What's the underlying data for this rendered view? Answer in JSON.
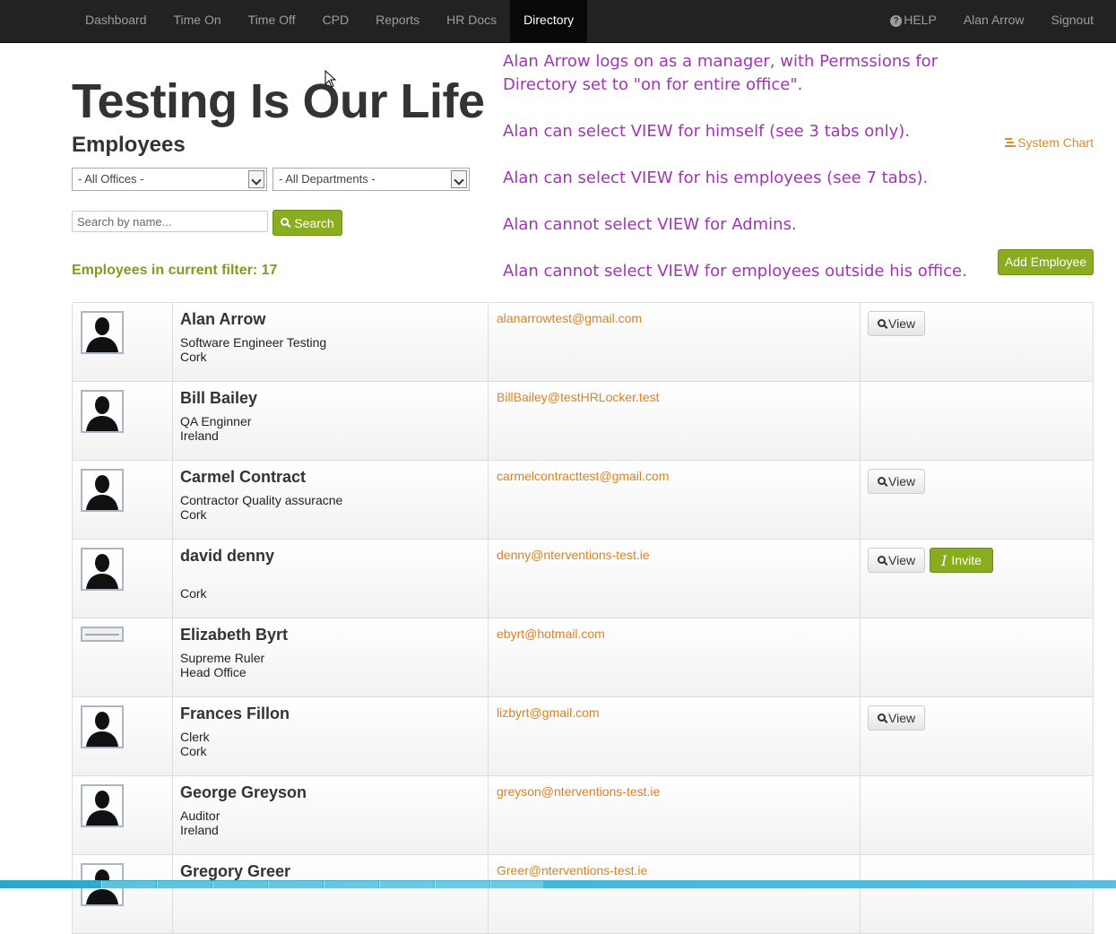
{
  "nav": {
    "left": [
      "Dashboard",
      "Time On",
      "Time Off",
      "CPD",
      "Reports",
      "HR Docs",
      "Directory"
    ],
    "active": "Directory",
    "help": "HELP",
    "user": "Alan Arrow",
    "signout": "Signout"
  },
  "header": {
    "company": "Testing Is Our Life",
    "section": "Employees"
  },
  "filters": {
    "offices": "- All Offices -",
    "departments": "- All Departments -",
    "search_placeholder": "Search by name...",
    "search_label": "Search",
    "count_label": "Employees in current filter: 17"
  },
  "annotations": [
    "Alan Arrow logs on as a manager, with Permssions for",
    "Directory set to \"on for entire office\".",
    "Alan can select VIEW for himself (see 3 tabs only).",
    "Alan can select VIEW for his employees (see 7 tabs).",
    "Alan cannot select VIEW for Admins.",
    "Alan cannot select VIEW for employees outside his office."
  ],
  "actions": {
    "system_chart": "System Chart",
    "add_employee": "Add Employee",
    "view_label": "View",
    "invite_label": "Invite"
  },
  "employees": [
    {
      "name": "Alan Arrow",
      "title": "Software Engineer Testing",
      "office": "Cork",
      "email": "alanarrowtest@gmail.com"
    },
    {
      "name": "Bill Bailey",
      "title": "QA Enginner",
      "office": "Ireland",
      "email": "BillBailey@testHRLocker.test"
    },
    {
      "name": "Carmel Contract",
      "title": "Contractor Quality assuracne",
      "office": "Cork",
      "email": "carmelcontracttest@gmail.com"
    },
    {
      "name": "david denny",
      "title": "",
      "office": "Cork",
      "email": "denny@nterventions-test.ie"
    },
    {
      "name": "Elizabeth Byrt",
      "title": "Supreme Ruler",
      "office": "Head Office",
      "email": "ebyrt@hotmail.com"
    },
    {
      "name": "Frances Fillon",
      "title": "Clerk",
      "office": "Cork",
      "email": "lizbyrt@gmail.com"
    },
    {
      "name": "George Greyson",
      "title": "Auditor",
      "office": "Ireland",
      "email": "greyson@nterventions-test.ie"
    },
    {
      "name": "Gregory Greer",
      "title": "",
      "office": "",
      "email": "Greer@nterventions-test.ie"
    }
  ]
}
